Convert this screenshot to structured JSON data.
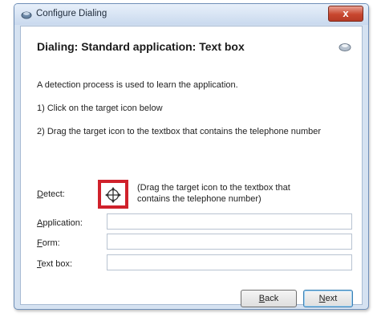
{
  "window": {
    "title": "Configure Dialing",
    "close_label": "x"
  },
  "header": {
    "title": "Dialing: Standard application: Text box"
  },
  "instructions": {
    "line1": "A detection process is used to learn the application.",
    "line2": "1) Click on the target icon below",
    "line3": "2) Drag the target icon to the textbox that contains the telephone number"
  },
  "detect": {
    "label_first": "D",
    "label_rest": "etect:",
    "hint": "(Drag the target icon to the textbox that contains the telephone number)"
  },
  "fields": {
    "application": {
      "label_first": "A",
      "label_rest": "pplication:",
      "value": ""
    },
    "form": {
      "label_first": "F",
      "label_rest": "orm:",
      "value": ""
    },
    "textbox": {
      "label_first": "T",
      "label_rest": "ext box:",
      "value": ""
    }
  },
  "buttons": {
    "back": {
      "first": "B",
      "rest": "ack"
    },
    "next": {
      "first": "N",
      "rest": "ext"
    }
  },
  "colors": {
    "target_border": "#d0212b",
    "close_button": "#c8472f"
  },
  "icons": [
    "window-app-icon",
    "close-icon",
    "header-icon",
    "target-crosshair-icon"
  ]
}
